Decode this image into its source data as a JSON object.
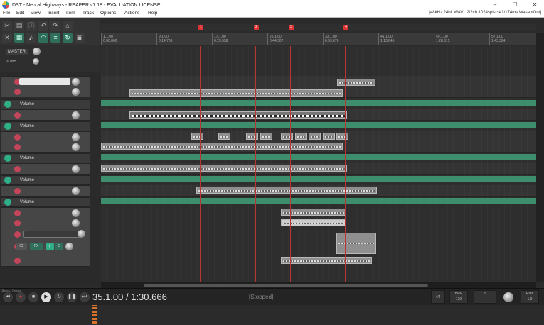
{
  "window": {
    "title": "DST - Neural Highways - REAPER v7.18 - EVALUATION LICENSE",
    "minimize": "–",
    "maximize": "☐",
    "close": "✕"
  },
  "menu": {
    "items": [
      "File",
      "Edit",
      "View",
      "Insert",
      "Item",
      "Track",
      "Options",
      "Actions",
      "Help"
    ],
    "info": "[48kHz 24bit WAV : 2/2ch 1024spls ~41/174ms WasapiOut]"
  },
  "master": {
    "label": "MASTER",
    "volume": "-6.0dB"
  },
  "tracks": {
    "env_label": "Volume"
  },
  "ruler": {
    "labels": [
      {
        "bar": "1.1.00",
        "time": "0:00.000"
      },
      {
        "bar": "9.1.00",
        "time": "0:14.769"
      },
      {
        "bar": "17.1.00",
        "time": "0:29.538"
      },
      {
        "bar": "25.1.00",
        "time": "0:44.307"
      },
      {
        "bar": "33.1.00",
        "time": "0:59.076"
      },
      {
        "bar": "41.1.00",
        "time": "1:13.846"
      },
      {
        "bar": "49.1.00",
        "time": "1:28.615"
      },
      {
        "bar": "57.1.00",
        "time": "1:43.384"
      }
    ],
    "markers": [
      "1",
      "2",
      "3",
      "4"
    ]
  },
  "transport": {
    "time": "35.1.00 / 1:30.666",
    "status": "[Stopped]",
    "sel_label": "Select Items",
    "timesig": "4/4",
    "bpm_label": "BPM",
    "bpm": "130",
    "rate_label": "Rate",
    "rate": "1.0"
  },
  "colors": {
    "accent": "#2fae88",
    "marker": "#dd3333",
    "envelope": "#3e8d6c",
    "record": "#c2455a"
  }
}
